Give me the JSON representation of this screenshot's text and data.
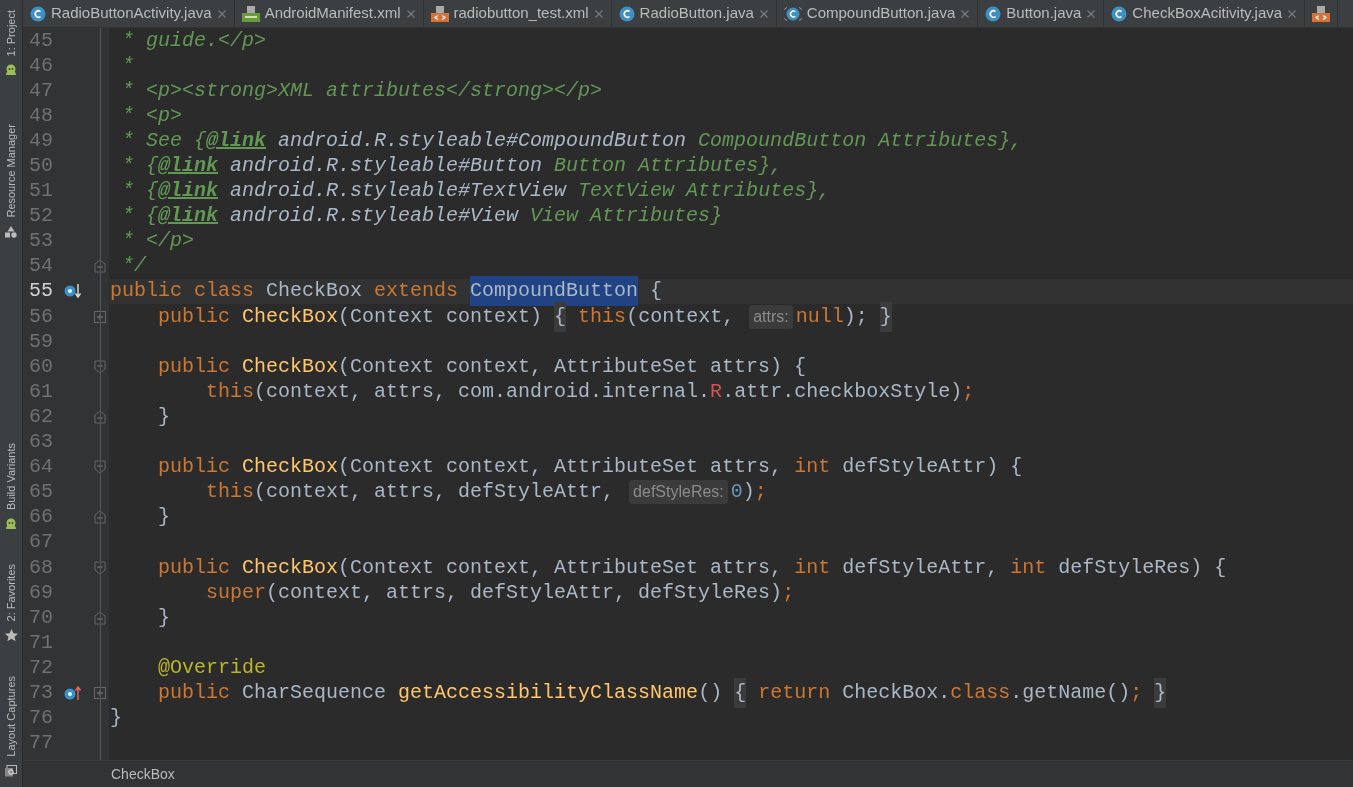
{
  "tabs": [
    {
      "label": "RadioButtonActivity.java",
      "kind": "class"
    },
    {
      "label": "AndroidManifest.xml",
      "kind": "manifest"
    },
    {
      "label": "radiobutton_test.xml",
      "kind": "layout"
    },
    {
      "label": "RadioButton.java",
      "kind": "class"
    },
    {
      "label": "CompoundButton.java",
      "kind": "library"
    },
    {
      "label": "Button.java",
      "kind": "class"
    },
    {
      "label": "CheckBoxAcitivity.java",
      "kind": "class"
    },
    {
      "kind": "layout"
    }
  ],
  "tool_windows": [
    {
      "label": "1: Project",
      "kind": "android"
    },
    {
      "label": "Resource Manager",
      "kind": "shapes"
    },
    {
      "label": "Build Variants",
      "kind": "android"
    },
    {
      "label": "2: Favorites",
      "kind": "star"
    },
    {
      "label": "Layout Captures",
      "kind": "capture"
    }
  ],
  "lines": [
    {
      "number": "45",
      "tokens": [
        {
          "kind": "comment",
          "t": " * guide.</p>"
        }
      ]
    },
    {
      "number": "46",
      "tokens": [
        {
          "kind": "comment",
          "t": " *"
        }
      ]
    },
    {
      "number": "47",
      "tokens": [
        {
          "kind": "comment",
          "t": " * <p><strong>XML attributes</strong></p>"
        }
      ]
    },
    {
      "number": "48",
      "tokens": [
        {
          "kind": "comment",
          "t": " * <p>"
        }
      ]
    },
    {
      "number": "49",
      "tokens": [
        {
          "kind": "comment",
          "t": " * See {"
        },
        {
          "kind": "doctag",
          "t": "@link"
        },
        {
          "kind": "docref",
          "t": " android.R.styleable#CompoundButton"
        },
        {
          "kind": "comment",
          "t": " CompoundButton Attributes},"
        }
      ]
    },
    {
      "number": "50",
      "tokens": [
        {
          "kind": "comment",
          "t": " * {"
        },
        {
          "kind": "doctag",
          "t": "@link"
        },
        {
          "kind": "docref",
          "t": " android.R.styleable#Button"
        },
        {
          "kind": "comment",
          "t": " Button Attributes},"
        }
      ]
    },
    {
      "number": "51",
      "tokens": [
        {
          "kind": "comment",
          "t": " * {"
        },
        {
          "kind": "doctag",
          "t": "@link"
        },
        {
          "kind": "docref",
          "t": " android.R.styleable#TextView"
        },
        {
          "kind": "comment",
          "t": " TextView Attributes},"
        }
      ]
    },
    {
      "number": "52",
      "tokens": [
        {
          "kind": "comment",
          "t": " * {"
        },
        {
          "kind": "doctag",
          "t": "@link"
        },
        {
          "kind": "docref",
          "t": " android.R.styleable#View"
        },
        {
          "kind": "comment",
          "t": " View Attributes}"
        }
      ]
    },
    {
      "number": "53",
      "tokens": [
        {
          "kind": "comment",
          "t": " * </p>"
        }
      ]
    },
    {
      "number": "54",
      "fold": {
        "kind": "end"
      },
      "tokens": [
        {
          "kind": "comment",
          "t": " */"
        }
      ]
    },
    {
      "number": "55",
      "marker": {
        "kind": "implemented"
      },
      "current": true,
      "tokens": [
        {
          "kind": "keyword",
          "t": "public class "
        },
        {
          "kind": "plain",
          "t": "CheckBox "
        },
        {
          "kind": "keyword",
          "t": "extends "
        },
        {
          "kind": "selected",
          "t": "CompoundButton"
        },
        {
          "kind": "plain",
          "t": " {"
        }
      ]
    },
    {
      "number": "56",
      "fold": {
        "kind": "collapsed"
      },
      "tokens": [
        {
          "kind": "keyword",
          "t": "    public "
        },
        {
          "kind": "method",
          "t": "CheckBox"
        },
        {
          "kind": "plain",
          "t": "(Context context) "
        },
        {
          "kind": "folded",
          "t": "{"
        },
        {
          "kind": "keyword",
          "t": " this"
        },
        {
          "kind": "plain",
          "t": "(context, "
        },
        {
          "kind": "hint",
          "t": "attrs:"
        },
        {
          "kind": "keyword",
          "t": "null"
        },
        {
          "kind": "plain",
          "t": "); "
        },
        {
          "kind": "folded",
          "t": "}"
        }
      ]
    },
    {
      "number": "59"
    },
    {
      "number": "60",
      "fold": {
        "kind": "start"
      },
      "tokens": [
        {
          "kind": "keyword",
          "t": "    public "
        },
        {
          "kind": "method",
          "t": "CheckBox"
        },
        {
          "kind": "plain",
          "t": "(Context context, AttributeSet attrs) {"
        }
      ]
    },
    {
      "number": "61",
      "tokens": [
        {
          "kind": "keyword",
          "t": "        this"
        },
        {
          "kind": "plain",
          "t": "(context, attrs, com.android.internal."
        },
        {
          "kind": "red",
          "t": "R"
        },
        {
          "kind": "plain",
          "t": ".attr.checkboxStyle)"
        },
        {
          "kind": "keyword",
          "t": ";"
        }
      ]
    },
    {
      "number": "62",
      "fold": {
        "kind": "end"
      },
      "tokens": [
        {
          "kind": "plain",
          "t": "    }"
        }
      ]
    },
    {
      "number": "63"
    },
    {
      "number": "64",
      "fold": {
        "kind": "start"
      },
      "tokens": [
        {
          "kind": "keyword",
          "t": "    public "
        },
        {
          "kind": "method",
          "t": "CheckBox"
        },
        {
          "kind": "plain",
          "t": "(Context context, AttributeSet attrs, "
        },
        {
          "kind": "keyword",
          "t": "int "
        },
        {
          "kind": "plain",
          "t": "defStyleAttr) {"
        }
      ]
    },
    {
      "number": "65",
      "tokens": [
        {
          "kind": "keyword",
          "t": "        this"
        },
        {
          "kind": "plain",
          "t": "(context, attrs, defStyleAttr, "
        },
        {
          "kind": "hint",
          "t": "defStyleRes:"
        },
        {
          "kind": "number",
          "t": "0"
        },
        {
          "kind": "plain",
          "t": ")"
        },
        {
          "kind": "keyword",
          "t": ";"
        }
      ]
    },
    {
      "number": "66",
      "fold": {
        "kind": "end"
      },
      "tokens": [
        {
          "kind": "plain",
          "t": "    }"
        }
      ]
    },
    {
      "number": "67"
    },
    {
      "number": "68",
      "fold": {
        "kind": "start"
      },
      "tokens": [
        {
          "kind": "keyword",
          "t": "    public "
        },
        {
          "kind": "method",
          "t": "CheckBox"
        },
        {
          "kind": "plain",
          "t": "(Context context, AttributeSet attrs, "
        },
        {
          "kind": "keyword",
          "t": "int "
        },
        {
          "kind": "plain",
          "t": "defStyleAttr, "
        },
        {
          "kind": "keyword",
          "t": "int "
        },
        {
          "kind": "plain",
          "t": "defStyleRes) {"
        }
      ]
    },
    {
      "number": "69",
      "tokens": [
        {
          "kind": "keyword",
          "t": "        super"
        },
        {
          "kind": "plain",
          "t": "(context, attrs, defStyleAttr, defStyleRes)"
        },
        {
          "kind": "keyword",
          "t": ";"
        }
      ]
    },
    {
      "number": "70",
      "fold": {
        "kind": "end"
      },
      "tokens": [
        {
          "kind": "plain",
          "t": "    }"
        }
      ]
    },
    {
      "number": "71"
    },
    {
      "number": "72",
      "tokens": [
        {
          "kind": "annotation",
          "t": "    @Override"
        }
      ]
    },
    {
      "number": "73",
      "marker": {
        "kind": "overrides"
      },
      "fold": {
        "kind": "collapsed"
      },
      "tokens": [
        {
          "kind": "keyword",
          "t": "    public "
        },
        {
          "kind": "plain",
          "t": "CharSequence "
        },
        {
          "kind": "method",
          "t": "getAccessibilityClassName"
        },
        {
          "kind": "plain",
          "t": "() "
        },
        {
          "kind": "folded",
          "t": "{"
        },
        {
          "kind": "keyword",
          "t": " return "
        },
        {
          "kind": "plain",
          "t": "CheckBox."
        },
        {
          "kind": "keyword",
          "t": "class"
        },
        {
          "kind": "plain",
          "t": ".getName()"
        },
        {
          "kind": "keyword",
          "t": "; "
        },
        {
          "kind": "folded",
          "t": "}"
        }
      ]
    },
    {
      "number": "76",
      "tokens": [
        {
          "kind": "plain",
          "t": "}"
        }
      ]
    },
    {
      "number": "77"
    }
  ],
  "breadcrumb": "CheckBox"
}
